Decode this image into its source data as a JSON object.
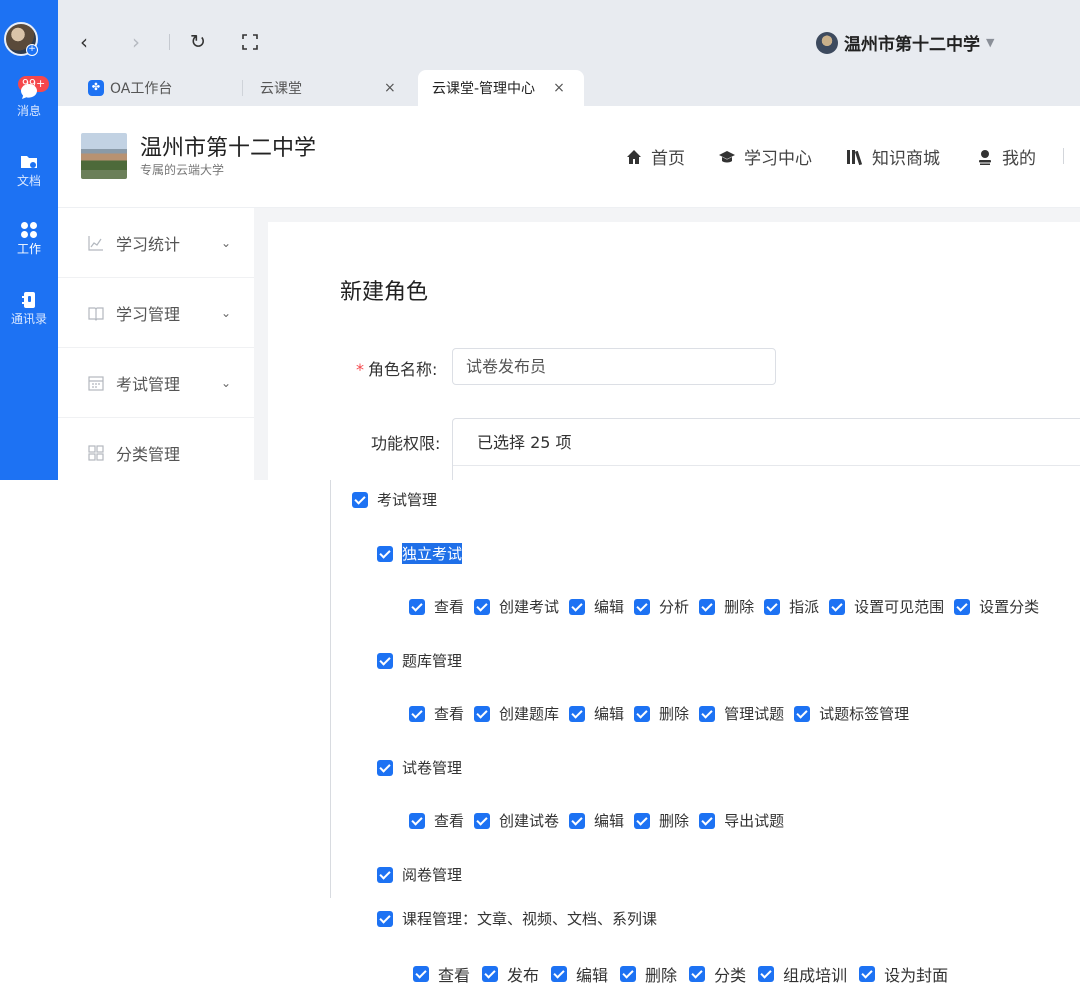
{
  "rail": {
    "badge": "99+",
    "items": [
      {
        "label": "消息"
      },
      {
        "label": "文档"
      },
      {
        "label": "工作"
      },
      {
        "label": "通讯录"
      }
    ]
  },
  "browser": {
    "school_name": "温州市第十二中学",
    "tabs": [
      {
        "label": "OA工作台"
      },
      {
        "label": "云课堂",
        "close": "×"
      },
      {
        "label": "云课堂-管理中心",
        "close": "×"
      }
    ]
  },
  "header": {
    "title": "温州市第十二中学",
    "subtitle": "专属的云端大学",
    "nav": [
      {
        "label": "首页",
        "icon": "home-icon"
      },
      {
        "label": "学习中心",
        "icon": "graduation-cap-icon"
      },
      {
        "label": "知识商城",
        "icon": "books-icon"
      },
      {
        "label": "我的",
        "icon": "user-icon"
      }
    ]
  },
  "sidemenu": {
    "items": [
      {
        "label": "学习统计",
        "icon": "chart-icon"
      },
      {
        "label": "学习管理",
        "icon": "book-icon"
      },
      {
        "label": "考试管理",
        "icon": "calendar-icon"
      },
      {
        "label": "分类管理",
        "icon": "grid-icon"
      }
    ]
  },
  "form": {
    "page_title": "新建角色",
    "role_name_label": "角色名称:",
    "role_name_value": "试卷发布员",
    "perm_label": "功能权限:",
    "perm_count": "已选择 25 项"
  },
  "tree": {
    "exam_mgmt": "考试管理",
    "standalone": {
      "title": "独立考试",
      "items": [
        "查看",
        "创建考试",
        "编辑",
        "分析",
        "删除",
        "指派",
        "设置可见范围",
        "设置分类"
      ]
    },
    "bank": {
      "title": "题库管理",
      "items": [
        "查看",
        "创建题库",
        "编辑",
        "删除",
        "管理试题",
        "试题标签管理"
      ]
    },
    "paper": {
      "title": "试卷管理",
      "items": [
        "查看",
        "创建试卷",
        "编辑",
        "删除",
        "导出试题"
      ]
    },
    "grading": {
      "title": "阅卷管理"
    },
    "course": {
      "title": "课程管理：文章、视频、文档、系列课",
      "items": [
        "查看",
        "发布",
        "编辑",
        "删除",
        "分类",
        "组成培训",
        "设为封面"
      ]
    }
  }
}
